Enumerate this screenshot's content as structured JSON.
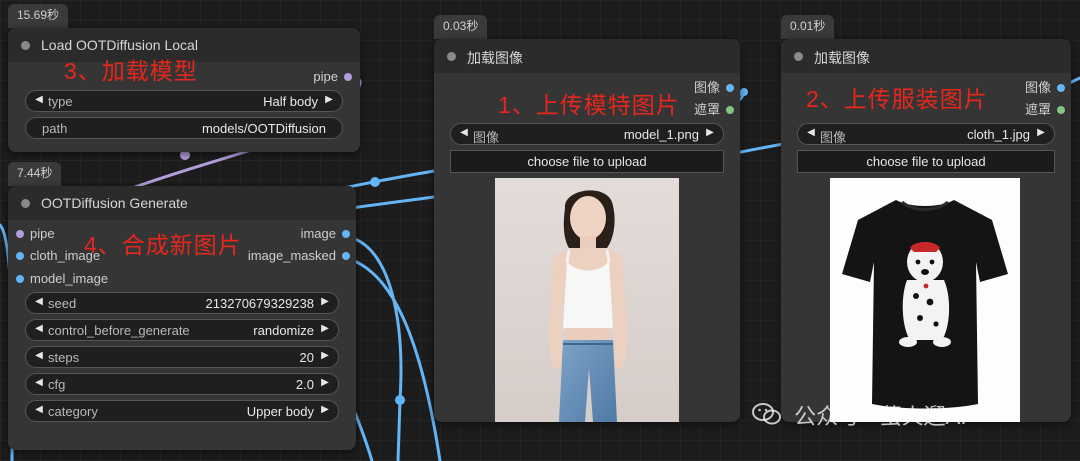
{
  "colors": {
    "canvas": "#1c1c1c",
    "node_body": "#353535",
    "node_header": "#2b2b2b",
    "slot_model": "#b39ddb",
    "slot_image": "#64b5f6",
    "slot_mask": "#81c784",
    "wire_blue": "#64b5f6",
    "wire_purple": "#b39ddb",
    "annotation_red": "#e8261b"
  },
  "nodes": {
    "load_model": {
      "timing": "15.69秒",
      "title": "Load OOTDiffusion Local",
      "annotation": "3、加载模型",
      "outputs": [
        {
          "label": "pipe",
          "type": "model"
        }
      ],
      "widgets": {
        "type": {
          "label": "type",
          "value": "Half body"
        },
        "path": {
          "label": "path",
          "value": "models/OOTDiffusion"
        }
      }
    },
    "generate": {
      "timing": "7.44秒",
      "title": "OOTDiffusion Generate",
      "annotation": "4、合成新图片",
      "inputs": [
        "pipe",
        "cloth_image",
        "model_image"
      ],
      "outputs": [
        "image",
        "image_masked"
      ],
      "widgets": [
        {
          "label": "seed",
          "value": "213270679329238"
        },
        {
          "label": "control_before_generate",
          "value": "randomize"
        },
        {
          "label": "steps",
          "value": "20"
        },
        {
          "label": "cfg",
          "value": "2.0"
        },
        {
          "label": "category",
          "value": "Upper body"
        }
      ]
    },
    "load_model_image": {
      "timing": "0.03秒",
      "title": "加载图像",
      "annotation": "1、上传模特图片",
      "outputs": [
        "图像",
        "遮罩"
      ],
      "image_widget": {
        "label": "图像",
        "value": "model_1.png"
      },
      "upload_label": "choose file to upload"
    },
    "load_cloth_image": {
      "timing": "0.01秒",
      "title": "加载图像",
      "annotation": "2、上传服装图片",
      "outputs": [
        "图像",
        "遮罩"
      ],
      "image_widget": {
        "label": "图像",
        "value": "cloth_1.jpg"
      },
      "upload_label": "choose file to upload"
    }
  },
  "watermark": {
    "text": "公众号 · 萤火遛AI",
    "icon": "wechat-icon"
  }
}
